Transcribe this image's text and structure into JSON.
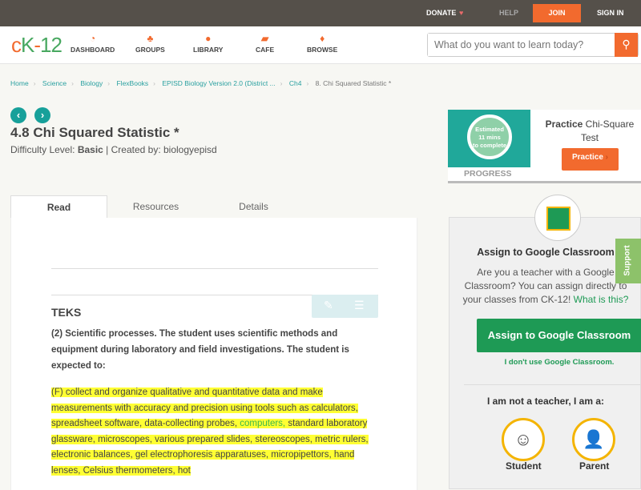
{
  "topbar": {
    "donate": "DONATE",
    "help": "HELP",
    "join": "JOIN",
    "signin": "SIGN IN"
  },
  "nav": {
    "logo": "cK-12",
    "items": [
      {
        "label": "DASHBOARD",
        "icon": "dashboard-icon"
      },
      {
        "label": "GROUPS",
        "icon": "groups-icon"
      },
      {
        "label": "LIBRARY",
        "icon": "library-icon"
      },
      {
        "label": "CAFE",
        "icon": "cafe-icon"
      },
      {
        "label": "BROWSE",
        "icon": "browse-icon"
      }
    ],
    "search_placeholder": "What do you want to learn today?"
  },
  "breadcrumb": [
    "Home",
    "Science",
    "Biology",
    "FlexBooks",
    "EPISD Biology Version 2.0 (District ...",
    "Ch4",
    "8. Chi Squared Statistic *"
  ],
  "page": {
    "title": "4.8 Chi Squared Statistic *",
    "difficulty_label": "Difficulty Level: ",
    "difficulty": "Basic",
    "created": " | Created by: biologyepisd"
  },
  "tabs": [
    "Read",
    "Resources",
    "Details"
  ],
  "content": {
    "heading": "TEKS",
    "para": "(2)  Scientific processes. The student uses scientific methods and equipment during laboratory and field investigations. The student is expected to:",
    "hl1": "(F)  collect and organize qualitative and quantitative data and make measurements with accuracy and precision using tools such as calculators, spreadsheet software, data-collecting probes, ",
    "hl_link": "computers,",
    "hl2": " standard laboratory glassware, microscopes, various prepared slides, stereoscopes, metric rulers, electronic balances, gel electrophoresis apparatuses, micropipettors, hand lenses, Celsius thermometers, hot"
  },
  "practice": {
    "estimated": "Estimated",
    "mins": "11 mins",
    "complete": "to complete",
    "progress": "PROGRESS",
    "title_bold": "Practice",
    "title": " Chi-Square Test",
    "button": "Practice"
  },
  "classroom": {
    "title": "Assign to Google Classroom",
    "desc": "Are you a teacher with a Google Classroom? You can assign directly to your classes from CK-12! ",
    "link": "What is this?",
    "button": "Assign to Google Classroom",
    "dont": "I don't use Google Classroom.",
    "not_teacher": "I am not a teacher, I am a:",
    "student": "Student",
    "parent": "Parent"
  },
  "support": "Support"
}
